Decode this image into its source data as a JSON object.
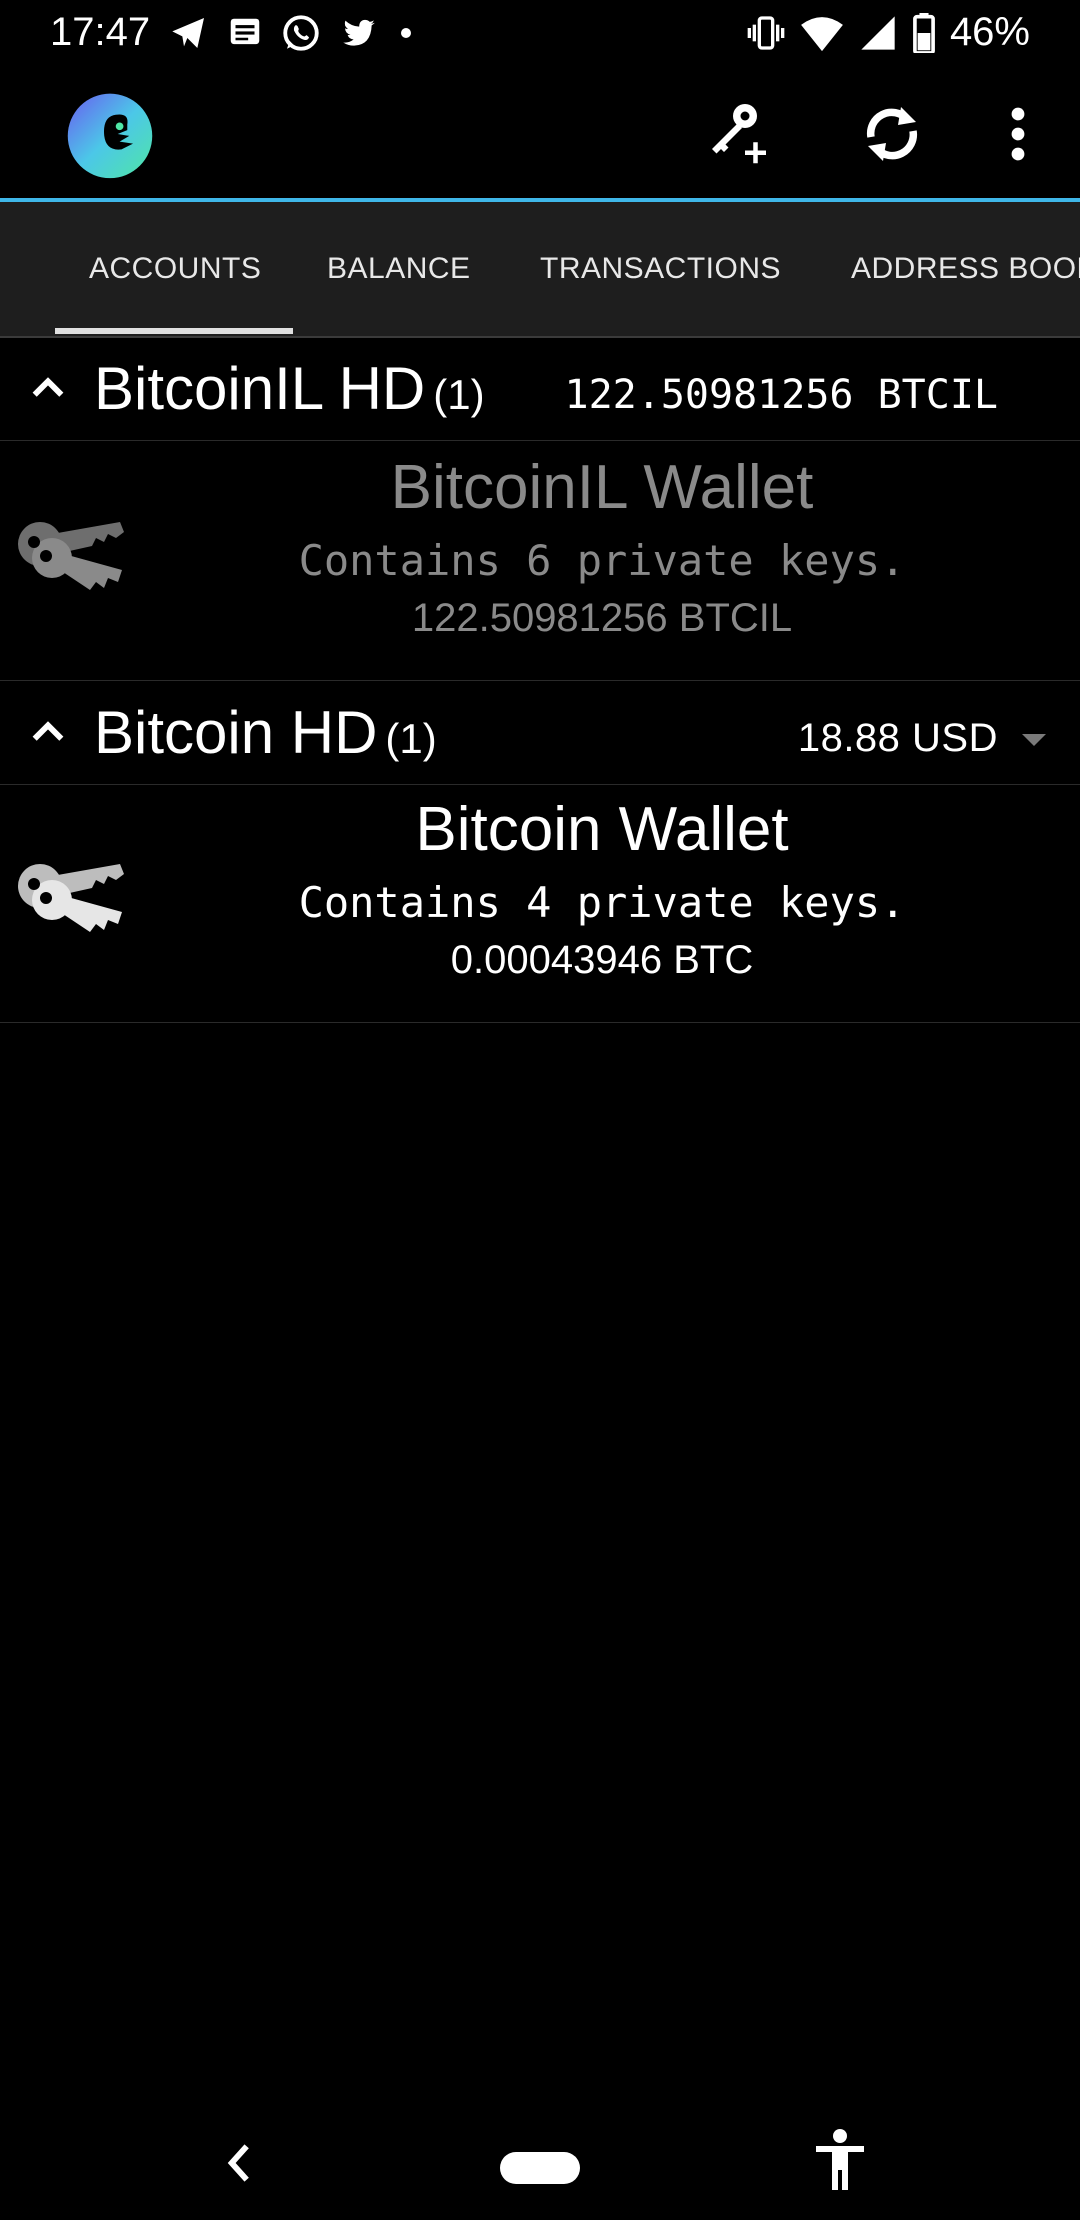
{
  "status_bar": {
    "time": "17:47",
    "battery": "46%",
    "left_icons": [
      "telegram-icon",
      "messages-icon",
      "whatsapp-icon",
      "twitter-icon",
      "dot-icon"
    ],
    "right_icons": [
      "vibrate-icon",
      "wifi-icon",
      "signal-icon",
      "battery-icon"
    ]
  },
  "app_bar": {
    "logo": "app-logo",
    "actions": [
      "add-key-icon",
      "refresh-icon",
      "overflow-menu-icon"
    ]
  },
  "tabs": [
    {
      "label": "ACCOUNTS",
      "selected": true
    },
    {
      "label": "BALANCE",
      "selected": false
    },
    {
      "label": "TRANSACTIONS",
      "selected": false
    },
    {
      "label": "ADDRESS BOOK",
      "selected": false
    }
  ],
  "groups": [
    {
      "title": "BitcoinIL HD",
      "count": "(1)",
      "balance": "122.50981256 BTCIL",
      "account": {
        "name": "BitcoinIL Wallet",
        "keys": "Contains 6 private keys.",
        "balance": "122.50981256 BTCIL",
        "dimmed": true
      }
    },
    {
      "title": "Bitcoin HD",
      "count": "(1)",
      "balance": "18.88 USD",
      "account": {
        "name": "Bitcoin Wallet",
        "keys": "Contains 4 private keys.",
        "balance": "0.00043946 BTC",
        "dimmed": false
      }
    }
  ],
  "colors": {
    "accent": "#3fb7e8",
    "tab_bar": "#1e1e1e",
    "background": "#000000",
    "dimmed_text": "#8a8a8a"
  },
  "nav_bar": {
    "items": [
      "back-icon",
      "home-pill",
      "accessibility-icon"
    ]
  }
}
